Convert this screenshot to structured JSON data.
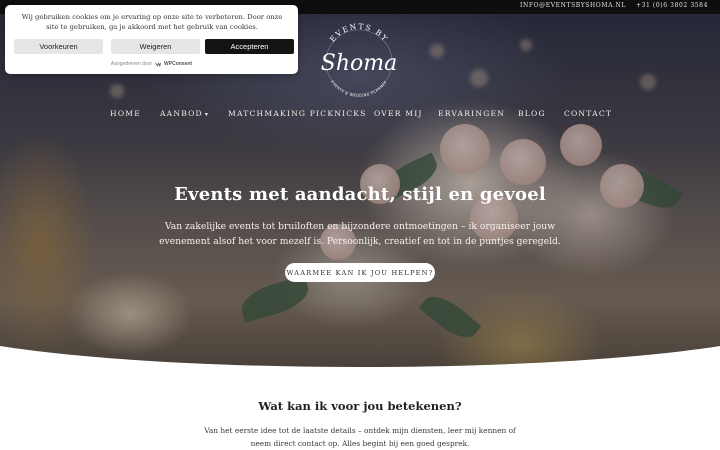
{
  "topbar": {
    "email": "INFO@EVENTSBYSHOMA.NL",
    "phone": "+31 (0)6 3802 3584"
  },
  "cookie_banner": {
    "message": "Wij gebruiken cookies om je ervaring op onze site te verbeteren. Door onze site te gebruiken, ga je akkoord met het gebruik van cookies.",
    "preferences_label": "Voorkeuren",
    "deny_label": "Weigeren",
    "accept_label": "Accepteren",
    "powered_by": "Aangedreven door",
    "powered_brand": "WPConsent"
  },
  "logo": {
    "top_text": "EVENTS BY",
    "script_text": "Shoma",
    "bottom_text": "EVENTS & WEDDING PLANNER"
  },
  "nav": {
    "items": [
      {
        "label": "HOME"
      },
      {
        "label": "AANBOD",
        "has_dropdown": true
      },
      {
        "label": "MATCHMAKING PICKNICKS"
      },
      {
        "label": "OVER MIJ"
      },
      {
        "label": "ERVARINGEN"
      },
      {
        "label": "BLOG"
      },
      {
        "label": "CONTACT"
      }
    ]
  },
  "hero": {
    "title": "Events met aandacht, stijl en gevoel",
    "subtitle": "Van zakelijke events tot bruiloften en bijzondere ontmoetingen – ik organiseer jouw evenement alsof het voor mezelf is. Persoonlijk, creatief en tot in de puntjes geregeld.",
    "cta_label": "WAARMEE KAN IK JOU HELPEN?"
  },
  "intro": {
    "title": "Wat kan ik voor jou betekenen?",
    "text": "Van het eerste idee tot de laatste details – ontdek mijn diensten, leer mij kennen of neem direct contact op. Alles begint bij een goed gesprek."
  },
  "colors": {
    "topbar_bg": "#0e0e10",
    "accept_button": "#141414",
    "neutral_button": "#e6e6e6",
    "hero_text": "#ffffff"
  }
}
